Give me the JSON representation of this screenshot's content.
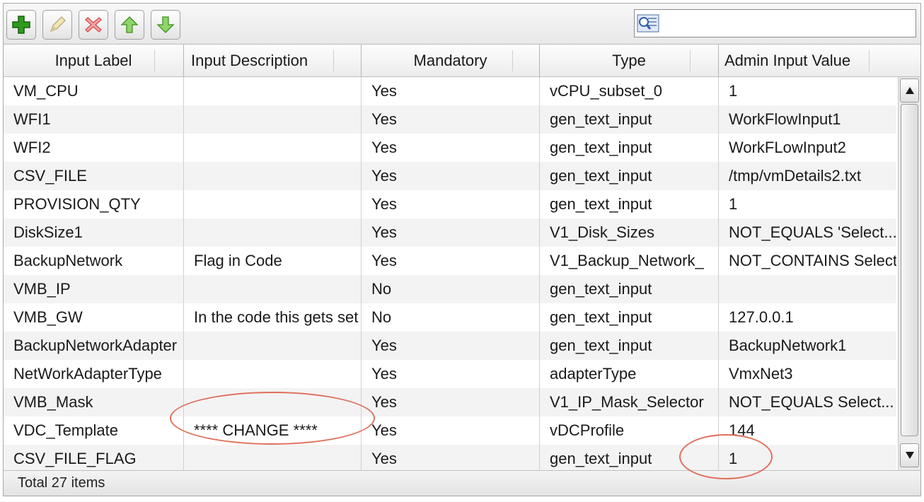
{
  "toolbar": {
    "buttons": [
      "add",
      "edit",
      "delete",
      "move-up",
      "move-down"
    ],
    "search": {
      "value": "",
      "placeholder": ""
    }
  },
  "columns": [
    "Input Label",
    "Input Description",
    "Mandatory",
    "Type",
    "Admin Input Value"
  ],
  "rows": [
    {
      "label": "VM_CPU",
      "description": "",
      "mandatory": "Yes",
      "type": "vCPU_subset_0",
      "value": "1"
    },
    {
      "label": "WFI1",
      "description": "",
      "mandatory": "Yes",
      "type": "gen_text_input",
      "value": "WorkFlowInput1"
    },
    {
      "label": "WFI2",
      "description": "",
      "mandatory": "Yes",
      "type": "gen_text_input",
      "value": "WorkFLowInput2"
    },
    {
      "label": "CSV_FILE",
      "description": "",
      "mandatory": "Yes",
      "type": "gen_text_input",
      "value": "/tmp/vmDetails2.txt"
    },
    {
      "label": "PROVISION_QTY",
      "description": "",
      "mandatory": "Yes",
      "type": "gen_text_input",
      "value": "1"
    },
    {
      "label": "DiskSize1",
      "description": "",
      "mandatory": "Yes",
      "type": "V1_Disk_Sizes",
      "value": "NOT_EQUALS 'Select...'"
    },
    {
      "label": "BackupNetwork",
      "description": "Flag in Code",
      "mandatory": "Yes",
      "type": "V1_Backup_Network_",
      "value": "NOT_CONTAINS Select"
    },
    {
      "label": "VMB_IP",
      "description": "",
      "mandatory": "No",
      "type": "gen_text_input",
      "value": ""
    },
    {
      "label": "VMB_GW",
      "description": "In the code this gets set",
      "mandatory": "No",
      "type": "gen_text_input",
      "value": "127.0.0.1"
    },
    {
      "label": "BackupNetworkAdapter",
      "description": "",
      "mandatory": "Yes",
      "type": "gen_text_input",
      "value": "BackupNetwork1"
    },
    {
      "label": "NetWorkAdapterType",
      "description": "",
      "mandatory": "Yes",
      "type": "adapterType",
      "value": "VmxNet3"
    },
    {
      "label": "VMB_Mask",
      "description": "",
      "mandatory": "Yes",
      "type": "V1_IP_Mask_Selector",
      "value": "NOT_EQUALS Select..."
    },
    {
      "label": "VDC_Template",
      "description": "**** CHANGE ****",
      "mandatory": "Yes",
      "type": "vDCProfile",
      "value": "144"
    },
    {
      "label": "CSV_FILE_FLAG",
      "description": "",
      "mandatory": "Yes",
      "type": "gen_text_input",
      "value": "1"
    }
  ],
  "footer": {
    "total_text": "Total 27 items"
  },
  "colors": {
    "annotation": "#df6f5c",
    "row_alt": "#f3f3f3",
    "add_icon": "#2f9a1e",
    "delete_icon": "#d84b4b",
    "arrow_icon": "#5db83a"
  }
}
